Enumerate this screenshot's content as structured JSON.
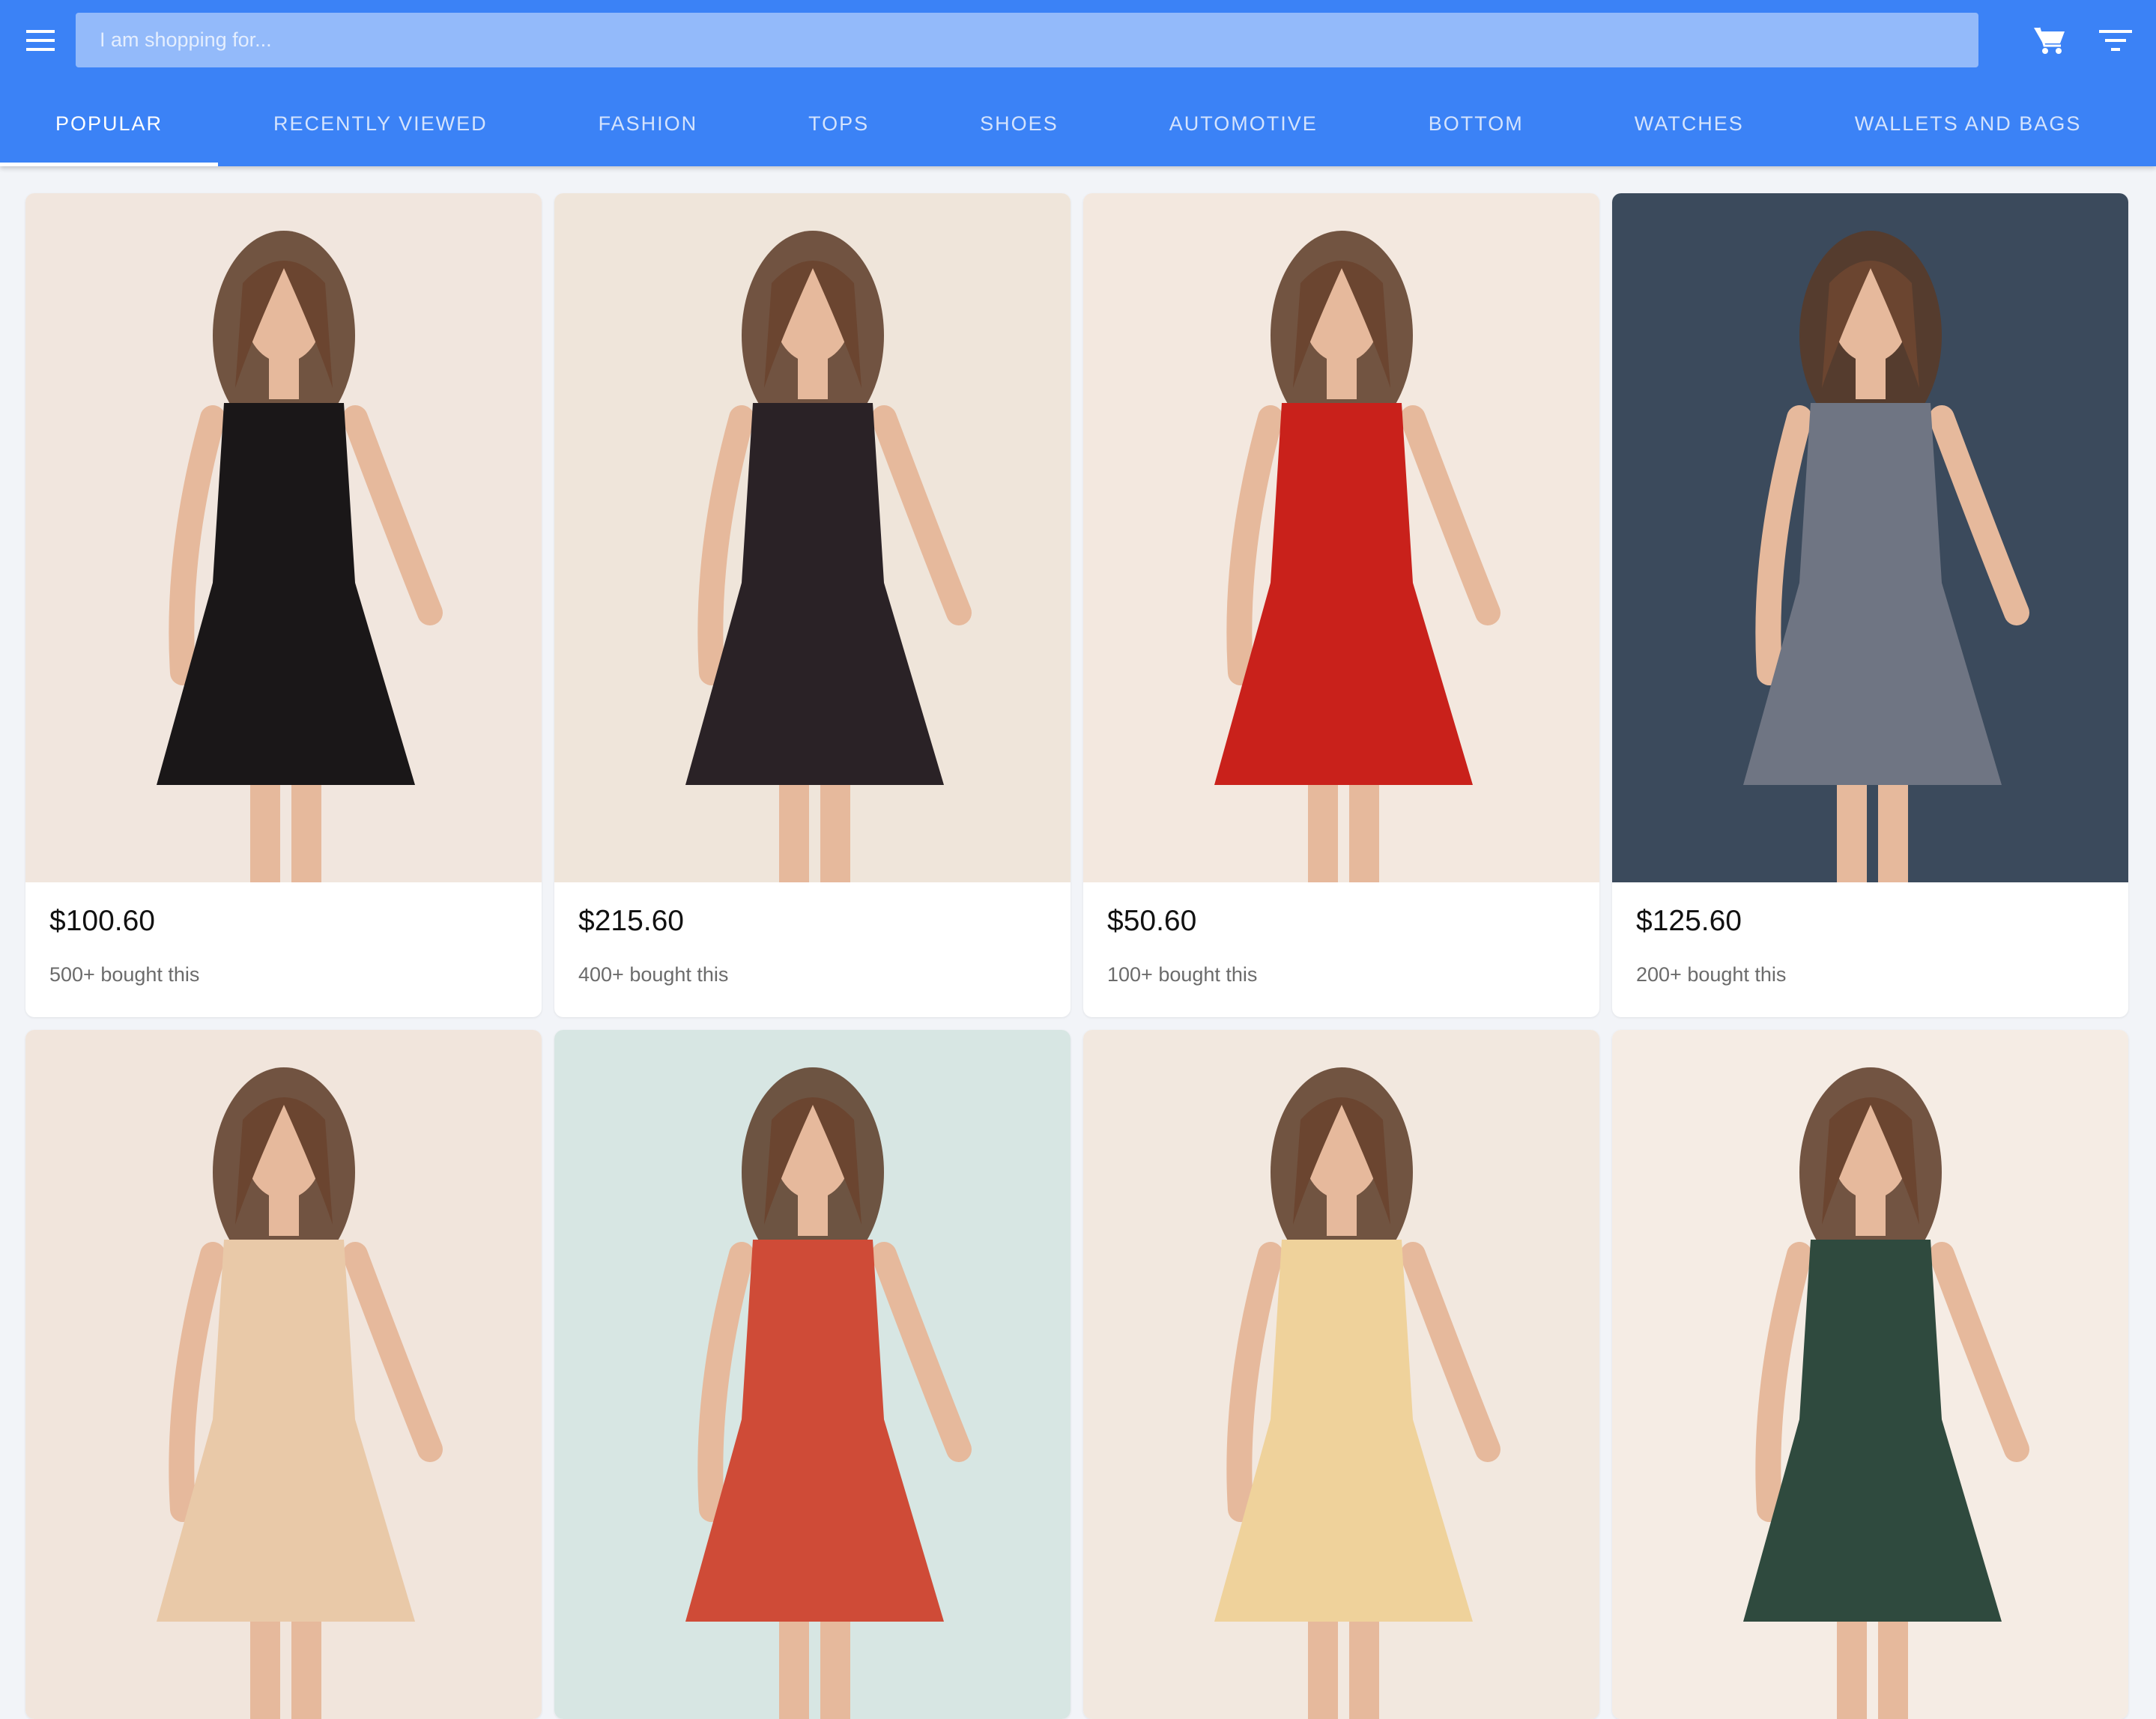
{
  "search": {
    "placeholder": "I am shopping for..."
  },
  "icons": {
    "menu": "hamburger-menu-icon",
    "cart": "shopping-cart-icon",
    "filter": "filter-icon"
  },
  "colors": {
    "appbar": "#3b82f6",
    "background": "#f2f4f8"
  },
  "tabs": [
    {
      "label": "POPULAR",
      "active": true
    },
    {
      "label": "RECENTLY VIEWED",
      "active": false
    },
    {
      "label": "FASHION",
      "active": false
    },
    {
      "label": "TOPS",
      "active": false
    },
    {
      "label": "SHOES",
      "active": false
    },
    {
      "label": "AUTOMOTIVE",
      "active": false
    },
    {
      "label": "BOTTOM",
      "active": false
    },
    {
      "label": "WATCHES",
      "active": false
    },
    {
      "label": "WALLETS AND BAGS",
      "active": false
    }
  ],
  "products": [
    {
      "price": "$100.60",
      "bought": "500+ bought this",
      "dress_color": "#1a1718",
      "bg": "#f1e6de"
    },
    {
      "price": "$215.60",
      "bought": "400+ bought this",
      "dress_color": "#2a2226",
      "bg": "#efe5da"
    },
    {
      "price": "$50.60",
      "bought": "100+ bought this",
      "dress_color": "#c9211b",
      "bg": "#f3e8df"
    },
    {
      "price": "$125.60",
      "bought": "200+ bought this",
      "dress_color": "#6f7583",
      "bg": "#3b4a5c"
    },
    {
      "price": "",
      "bought": "",
      "dress_color": "#e9c9a8",
      "bg": "#f1e5dc"
    },
    {
      "price": "",
      "bought": "",
      "dress_color": "#cf4b37",
      "bg": "#d7e6e3"
    },
    {
      "price": "",
      "bought": "",
      "dress_color": "#efd29b",
      "bg": "#f2e8df"
    },
    {
      "price": "",
      "bought": "",
      "dress_color": "#2f4a3e",
      "bg": "#f5ece4"
    }
  ]
}
